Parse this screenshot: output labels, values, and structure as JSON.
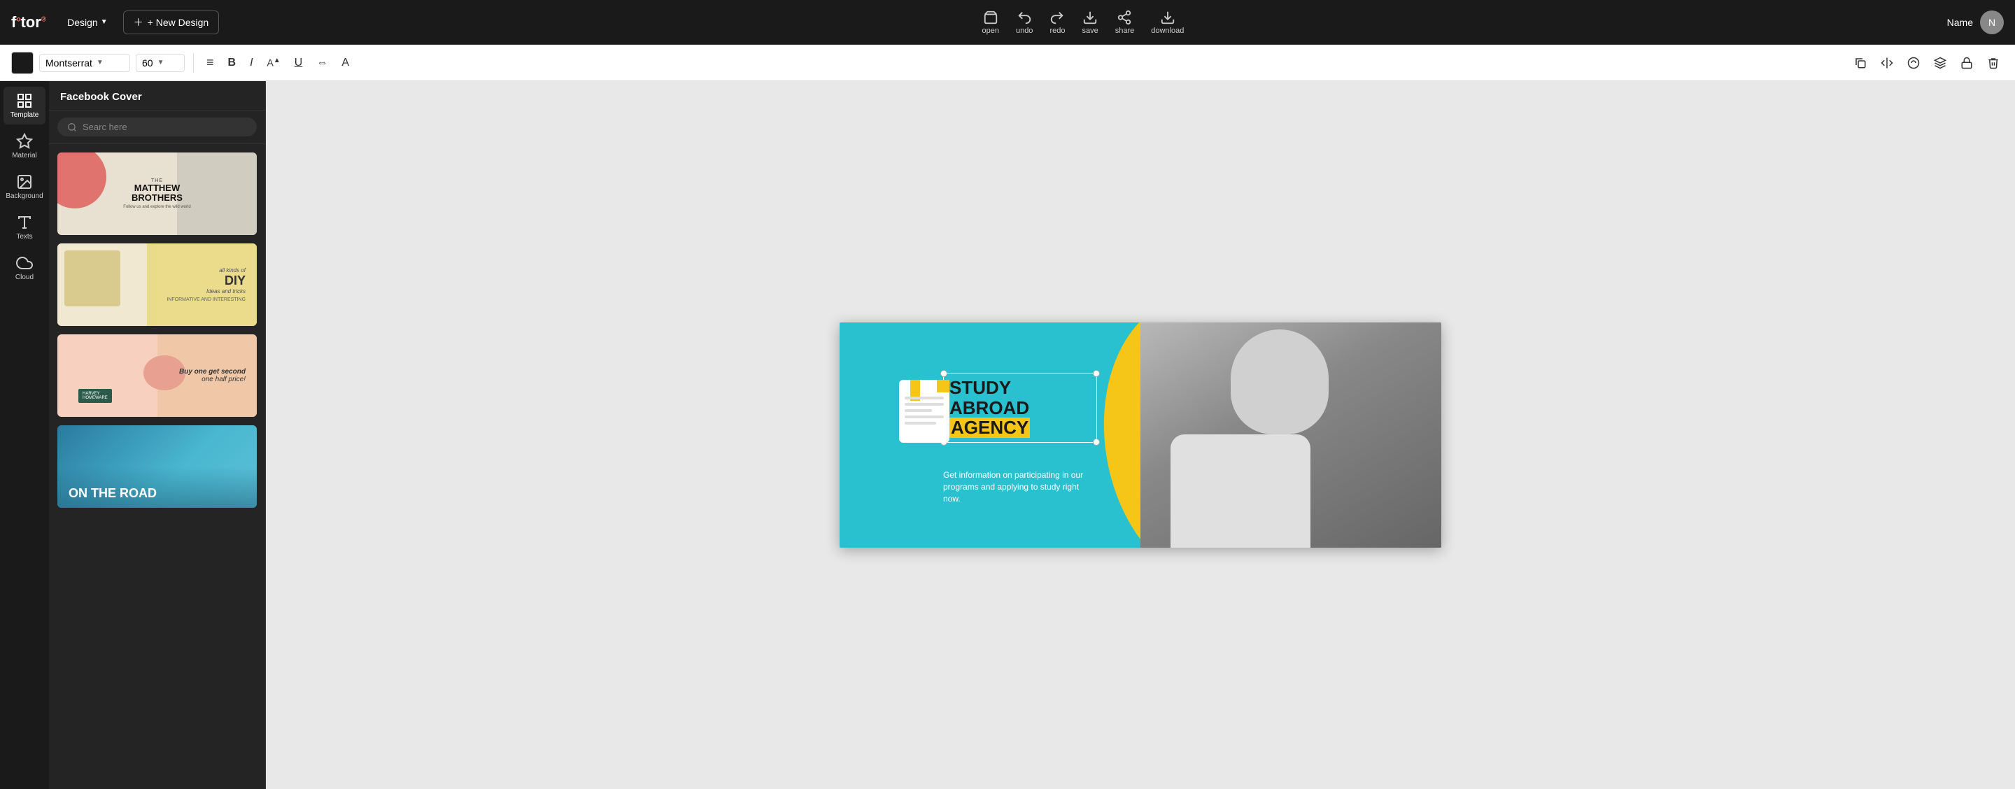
{
  "app": {
    "logo": "fotor",
    "logo_superscript": "®"
  },
  "top_toolbar": {
    "design_label": "Design",
    "new_design_label": "+ New Design",
    "actions": [
      {
        "id": "open",
        "label": "open",
        "icon": "open-icon"
      },
      {
        "id": "undo",
        "label": "undo",
        "icon": "undo-icon"
      },
      {
        "id": "redo",
        "label": "redo",
        "icon": "redo-icon"
      },
      {
        "id": "save",
        "label": "save",
        "icon": "save-icon"
      },
      {
        "id": "share",
        "label": "share",
        "icon": "share-icon"
      },
      {
        "id": "download",
        "label": "download",
        "icon": "download-icon"
      }
    ],
    "user": {
      "name": "Name",
      "avatar_initial": "N"
    }
  },
  "format_toolbar": {
    "color": "#1a1a1a",
    "font_family": "Montserrat",
    "font_size": "60",
    "buttons": [
      {
        "id": "align",
        "label": "≡",
        "name": "align-button"
      },
      {
        "id": "bold",
        "label": "B",
        "name": "bold-button"
      },
      {
        "id": "italic",
        "label": "I",
        "name": "italic-button"
      },
      {
        "id": "font-size-up",
        "label": "A▲",
        "name": "font-size-up-button"
      },
      {
        "id": "underline",
        "label": "U",
        "name": "underline-button"
      },
      {
        "id": "spacing",
        "label": "⇔",
        "name": "spacing-button"
      },
      {
        "id": "font-case",
        "label": "A",
        "name": "font-case-button"
      }
    ],
    "right_buttons": [
      {
        "id": "duplicate",
        "name": "duplicate-button",
        "icon": "duplicate-icon"
      },
      {
        "id": "flip",
        "name": "flip-button",
        "icon": "flip-icon"
      },
      {
        "id": "mask",
        "name": "mask-button",
        "icon": "mask-icon"
      },
      {
        "id": "layer",
        "name": "layer-button",
        "icon": "layer-icon"
      },
      {
        "id": "lock",
        "name": "lock-button",
        "icon": "lock-icon"
      },
      {
        "id": "delete",
        "name": "delete-button",
        "icon": "delete-icon"
      }
    ]
  },
  "sidebar": {
    "items": [
      {
        "id": "template",
        "label": "Template",
        "icon": "template-icon",
        "active": true
      },
      {
        "id": "material",
        "label": "Material",
        "icon": "material-icon",
        "active": false
      },
      {
        "id": "background",
        "label": "Background",
        "icon": "background-icon",
        "active": false
      },
      {
        "id": "texts",
        "label": "Texts",
        "icon": "texts-icon",
        "active": false
      },
      {
        "id": "cloud",
        "label": "Cloud",
        "icon": "cloud-icon",
        "active": false
      }
    ]
  },
  "template_panel": {
    "title": "Facebook Cover",
    "search_placeholder": "Searc here",
    "templates": [
      {
        "id": "matthew",
        "name": "The Matthew Brothers",
        "subtitle": "Follow us and explore the wild world",
        "style": "matthew"
      },
      {
        "id": "diy",
        "name": "all kinds of DIY ideas and tricks",
        "subtitle": "INFORMATIVE AND INTERESTING",
        "style": "diy"
      },
      {
        "id": "harvey",
        "name": "Buy one get second one half price!",
        "badge": "HARVEY HOMEWARE",
        "style": "harvey"
      },
      {
        "id": "road",
        "name": "ON THE ROAD",
        "style": "road"
      }
    ]
  },
  "canvas": {
    "title_line1": "STUDY ABROAD",
    "title_line2": "AGENCY",
    "subtitle": "Get information on participating in our programs and applying to study right now.",
    "colors": {
      "cyan": "#29c0cf",
      "yellow": "#f5c518",
      "dark": "#1a1a1a",
      "white": "#ffffff"
    }
  }
}
